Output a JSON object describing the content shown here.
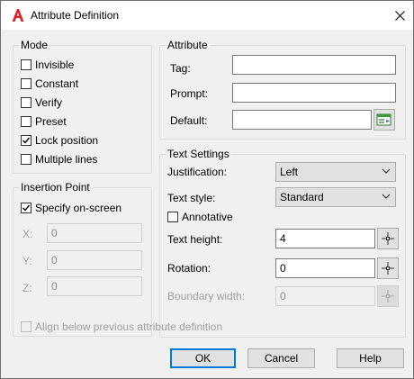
{
  "window": {
    "title": "Attribute Definition"
  },
  "mode": {
    "title": "Mode",
    "items": [
      {
        "label": "Invisible",
        "checked": false
      },
      {
        "label": "Constant",
        "checked": false
      },
      {
        "label": "Verify",
        "checked": false
      },
      {
        "label": "Preset",
        "checked": false
      },
      {
        "label": "Lock position",
        "checked": true
      },
      {
        "label": "Multiple lines",
        "checked": false
      }
    ]
  },
  "attribute": {
    "title": "Attribute",
    "tag_label": "Tag:",
    "tag_value": "",
    "prompt_label": "Prompt:",
    "prompt_value": "",
    "default_label": "Default:",
    "default_value": ""
  },
  "insertion": {
    "title": "Insertion Point",
    "specify_label": "Specify on-screen",
    "specify_checked": true,
    "x_label": "X:",
    "x_value": "0",
    "y_label": "Y:",
    "y_value": "0",
    "z_label": "Z:",
    "z_value": "0"
  },
  "text_settings": {
    "title": "Text Settings",
    "justification_label": "Justification:",
    "justification_value": "Left",
    "style_label": "Text style:",
    "style_value": "Standard",
    "annotative_label": "Annotative",
    "annotative_checked": false,
    "height_label": "Text height:",
    "height_value": "4",
    "rotation_label": "Rotation:",
    "rotation_value": "0",
    "boundary_label": "Boundary width:",
    "boundary_value": "0"
  },
  "align_below": {
    "label": "Align below previous attribute definition",
    "checked": false
  },
  "buttons": {
    "ok": "OK",
    "cancel": "Cancel",
    "help": "Help"
  },
  "colors": {
    "accent": "#0078d7",
    "app_icon_red": "#d6262b"
  }
}
